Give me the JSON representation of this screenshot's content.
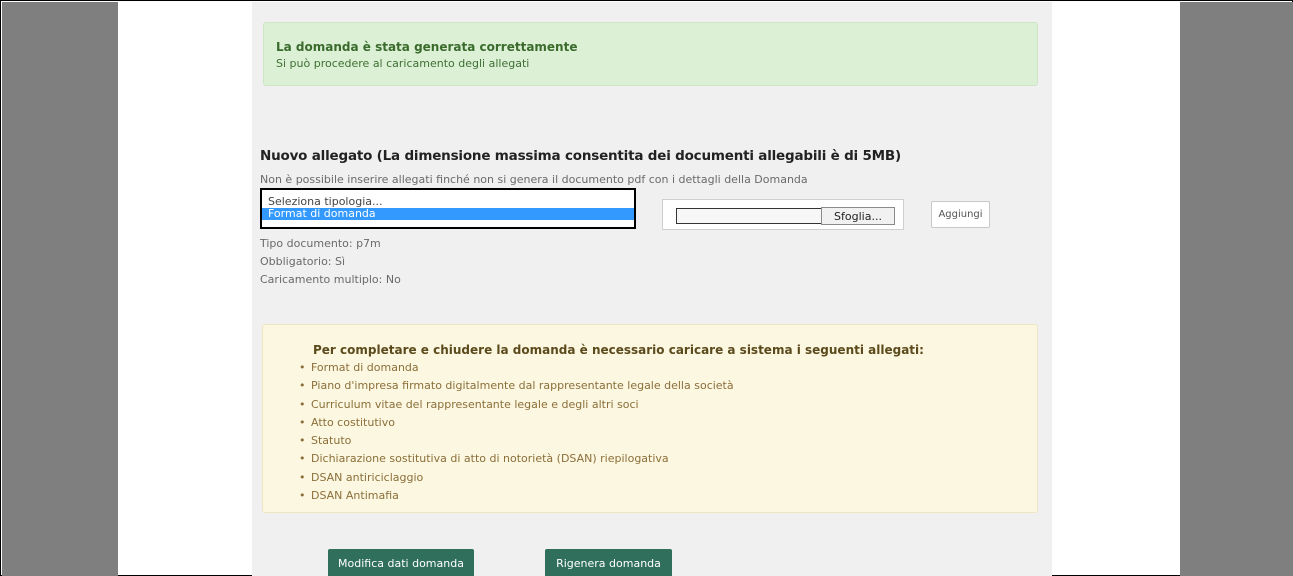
{
  "success_alert": {
    "title": "La domanda è stata generata correttamente",
    "message": "Si può procedere al caricamento degli allegati"
  },
  "new_attachment": {
    "title": "Nuovo allegato (La dimensione massima consentita dei documenti allegabili è di 5MB)",
    "note": "Non è possibile inserire allegati finché non si genera il documento pdf con i dettagli della Domanda",
    "select_options": [
      "Seleziona tipologia...",
      "Format di domanda"
    ],
    "selected_index": 1,
    "browse_label": "Sfoglia...",
    "add_label": "Aggiungi",
    "file_value": ""
  },
  "doc_info": {
    "tipo": "Tipo documento: p7m",
    "obbligatorio": "Obbligatorio: Sì",
    "multiplo": "Caricamento multiplo: No"
  },
  "required_alert": {
    "title": "Per completare e chiudere la domanda è necessario caricare a sistema i seguenti allegati:",
    "items": [
      "Format di domanda",
      "Piano d'impresa firmato digitalmente dal rappresentante legale della società",
      "Curriculum vitae del rappresentante legale e degli altri soci",
      "Atto costitutivo",
      "Statuto",
      "Dichiarazione sostitutiva di atto di notorietà (DSAN) riepilogativa",
      "DSAN antiriciclaggio",
      "DSAN Antimafia"
    ]
  },
  "buttons": {
    "modify": "Modifica dati domanda",
    "regenerate": "Rigenera domanda"
  },
  "colors": {
    "primary_button": "#2f6f5c",
    "success_bg": "#dcf0d6",
    "warning_bg": "#fcf7e0",
    "selection": "#3399ff"
  }
}
